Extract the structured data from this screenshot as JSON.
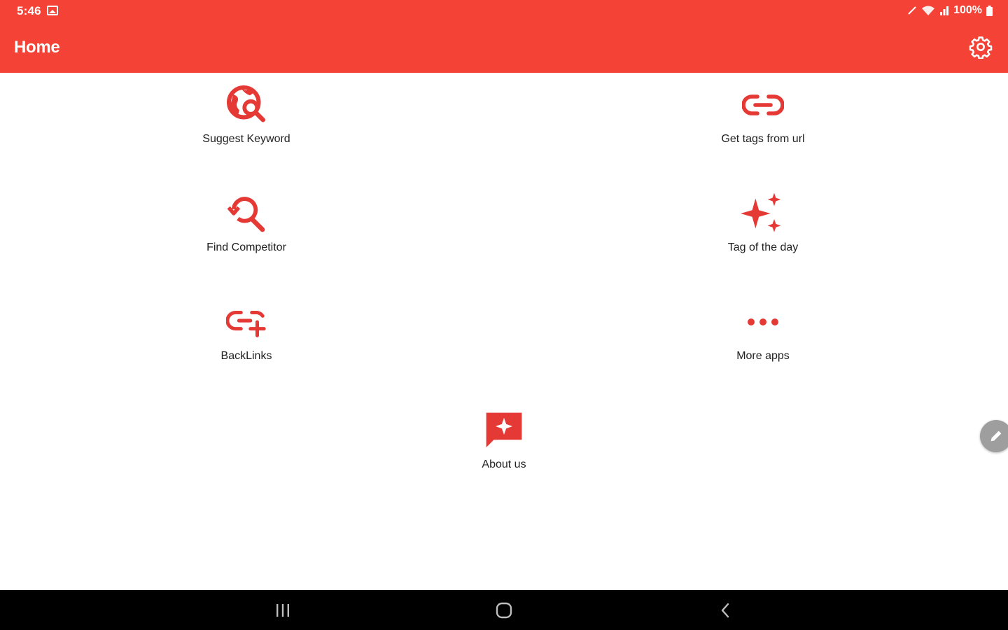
{
  "status_bar": {
    "time": "5:46",
    "battery": "100%"
  },
  "app_bar": {
    "title": "Home",
    "settings_icon": "gear-icon"
  },
  "menu": {
    "items": [
      {
        "label": "Suggest Keyword",
        "icon": "globe-search-icon"
      },
      {
        "label": "Get tags from url",
        "icon": "link-icon"
      },
      {
        "label": "Find Competitor",
        "icon": "search-history-icon"
      },
      {
        "label": "Tag of the day",
        "icon": "sparkles-icon"
      },
      {
        "label": "BackLinks",
        "icon": "add-link-icon"
      },
      {
        "label": "More apps",
        "icon": "more-horizontal-icon"
      },
      {
        "label": "About us",
        "icon": "feedback-star-icon"
      }
    ]
  },
  "floating": {
    "icon": "pencil-icon"
  },
  "nav_bar": {
    "recents_icon": "recents-icon",
    "home_icon": "home-icon",
    "back_icon": "back-icon"
  },
  "colors": {
    "accent": "#f44336",
    "icon": "#e53935",
    "text": "#222222",
    "nav_bg": "#000000"
  }
}
